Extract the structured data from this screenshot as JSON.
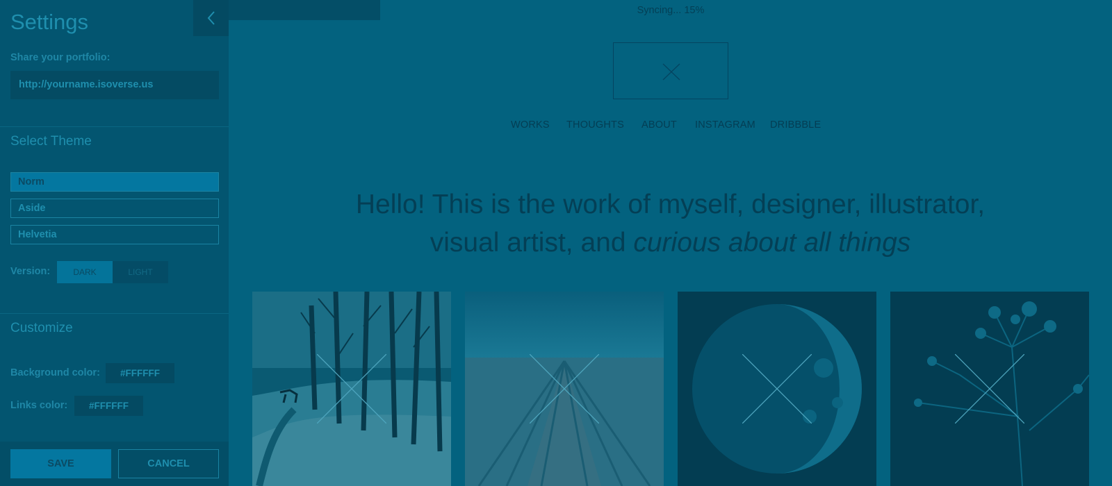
{
  "sidebar": {
    "title": "Settings",
    "share_label": "Share your portfolio:",
    "share_url": "http://yourname.isoverse.us",
    "theme_section_title": "Select Theme",
    "themes": [
      {
        "label": "Norm",
        "selected": true
      },
      {
        "label": "Aside",
        "selected": false
      },
      {
        "label": "Helvetia",
        "selected": false
      }
    ],
    "version_label": "Version:",
    "version_options": {
      "dark": "DARK",
      "light": "LIGHT",
      "selected": "DARK"
    },
    "customize_title": "Customize",
    "background_color_label": "Background color:",
    "background_color_value": "#FFFFFF",
    "links_color_label": "Links color:",
    "links_color_value": "#FFFFFF",
    "save_label": "SAVE",
    "cancel_label": "CANCEL",
    "back_icon": "chevron-left-icon"
  },
  "main": {
    "sync_status": "Syncing... 15%",
    "sync_progress": 0.15,
    "nav": [
      "WORKS",
      "THOUGHTS",
      "ABOUT",
      "INSTAGRAM",
      "DRIBBBLE"
    ],
    "hero_line1": "Hello! This is the work of myself, designer, illustrator,",
    "hero_line2_prefix": "visual artist, and ",
    "hero_line2_emphasis": "curious about all things",
    "tiles": [
      {
        "subject": "snowy-forest-fox"
      },
      {
        "subject": "snowy-field-road"
      },
      {
        "subject": "half-moon"
      },
      {
        "subject": "flower-silhouette"
      }
    ]
  },
  "colors": {
    "overlay": "#03627f",
    "sidebar_bg": "#035570",
    "accent": "#0477a0",
    "text_dark": "#043f55"
  }
}
